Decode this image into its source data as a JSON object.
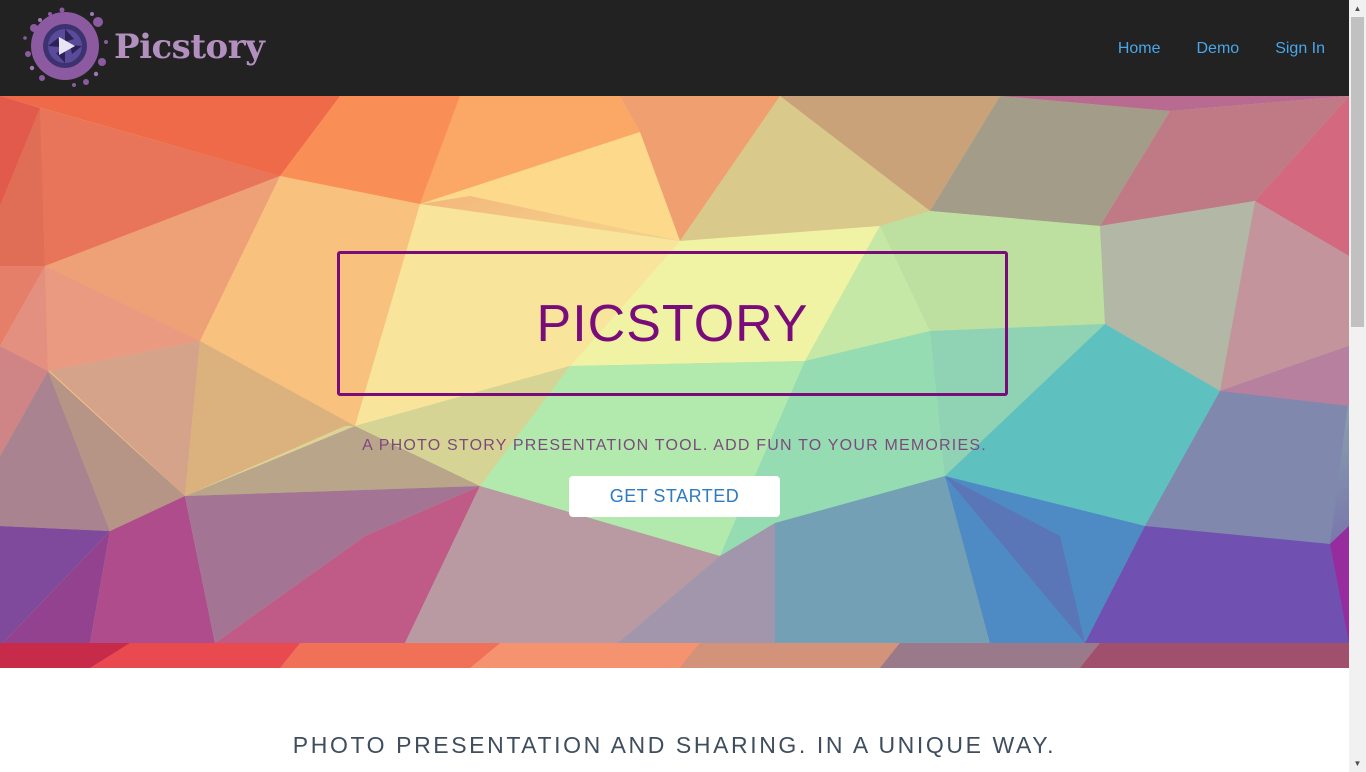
{
  "colors": {
    "navbar_bg": "#222222",
    "brand_color": "#b28fbf",
    "nav_link_color": "#4aa6e8",
    "title_color": "#7a0b7a",
    "cta_text_color": "#2e7bc2",
    "heading_color": "#3f4e5e"
  },
  "navbar": {
    "brand": "Picstory",
    "logo_icon": "camera-aperture-logo",
    "links": [
      {
        "label": "Home"
      },
      {
        "label": "Demo"
      },
      {
        "label": "Sign In"
      }
    ]
  },
  "hero": {
    "title": "PICSTORY",
    "tagline": "A PHOTO STORY PRESENTATION TOOL. ADD FUN TO YOUR MEMORIES.",
    "cta_label": "GET STARTED"
  },
  "section": {
    "heading": "PHOTO PRESENTATION AND SHARING. IN A UNIQUE WAY."
  },
  "scrollbar": {
    "up_icon": "scroll-up-arrow-icon",
    "down_icon": "scroll-down-arrow-icon"
  }
}
